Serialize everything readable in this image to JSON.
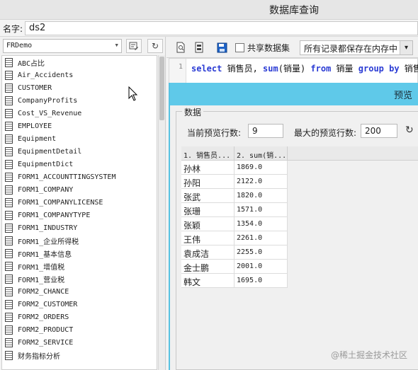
{
  "window": {
    "title": "数据库查询"
  },
  "name_row": {
    "label": "名字:",
    "value": "ds2"
  },
  "left_panel": {
    "connection": "FRDemo",
    "tables": [
      "ABC占比",
      "Air_Accidents",
      "CUSTOMER",
      "CompanyProfits",
      "Cost_VS_Revenue",
      "EMPLOYEE",
      "Equipment",
      "EquipmentDetail",
      "EquipmentDict",
      "FORM1_ACCOUNTTINGSYSTEM",
      "FORM1_COMPANY",
      "FORM1_COMPANYLICENSE",
      "FORM1_COMPANYTYPE",
      "FORM1_INDUSTRY",
      "FORM1_企业所得税",
      "FORM1_基本信息",
      "FORM1_增值税",
      "FORM1_营业税",
      "FORM2_CHANCE",
      "FORM2_CUSTOMER",
      "FORM2_ORDERS",
      "FORM2_PRODUCT",
      "FORM2_SERVICE",
      "财务指标分析"
    ]
  },
  "toolbar": {
    "share_label": "共享数据集",
    "storage_option": "所有记录都保存在内存中"
  },
  "editor": {
    "line_number": "1",
    "sql": {
      "kw_select": "select",
      "t1": " 销售员, ",
      "fn_sum": "sum",
      "t2": "(销量) ",
      "kw_from": "from",
      "t3": " 销量 ",
      "kw_group": "group by",
      "t4": " 销售"
    }
  },
  "preview": {
    "title": "预览",
    "group_label": "数据",
    "rows_label": "当前预览行数:",
    "rows_value": "9",
    "max_label": "最大的预览行数:",
    "max_value": "200",
    "columns": [
      "1. 销售员...",
      "2. sum(销..."
    ],
    "rows": [
      [
        "孙林",
        "1869.0"
      ],
      [
        "孙阳",
        "2122.0"
      ],
      [
        "张武",
        "1820.0"
      ],
      [
        "张珊",
        "1571.0"
      ],
      [
        "张颖",
        "1354.0"
      ],
      [
        "王伟",
        "2261.0"
      ],
      [
        "袁成洁",
        "2255.0"
      ],
      [
        "金士鹏",
        "2001.0"
      ],
      [
        "韩文",
        "1695.0"
      ]
    ]
  },
  "watermark": "@稀土掘金技术社区"
}
